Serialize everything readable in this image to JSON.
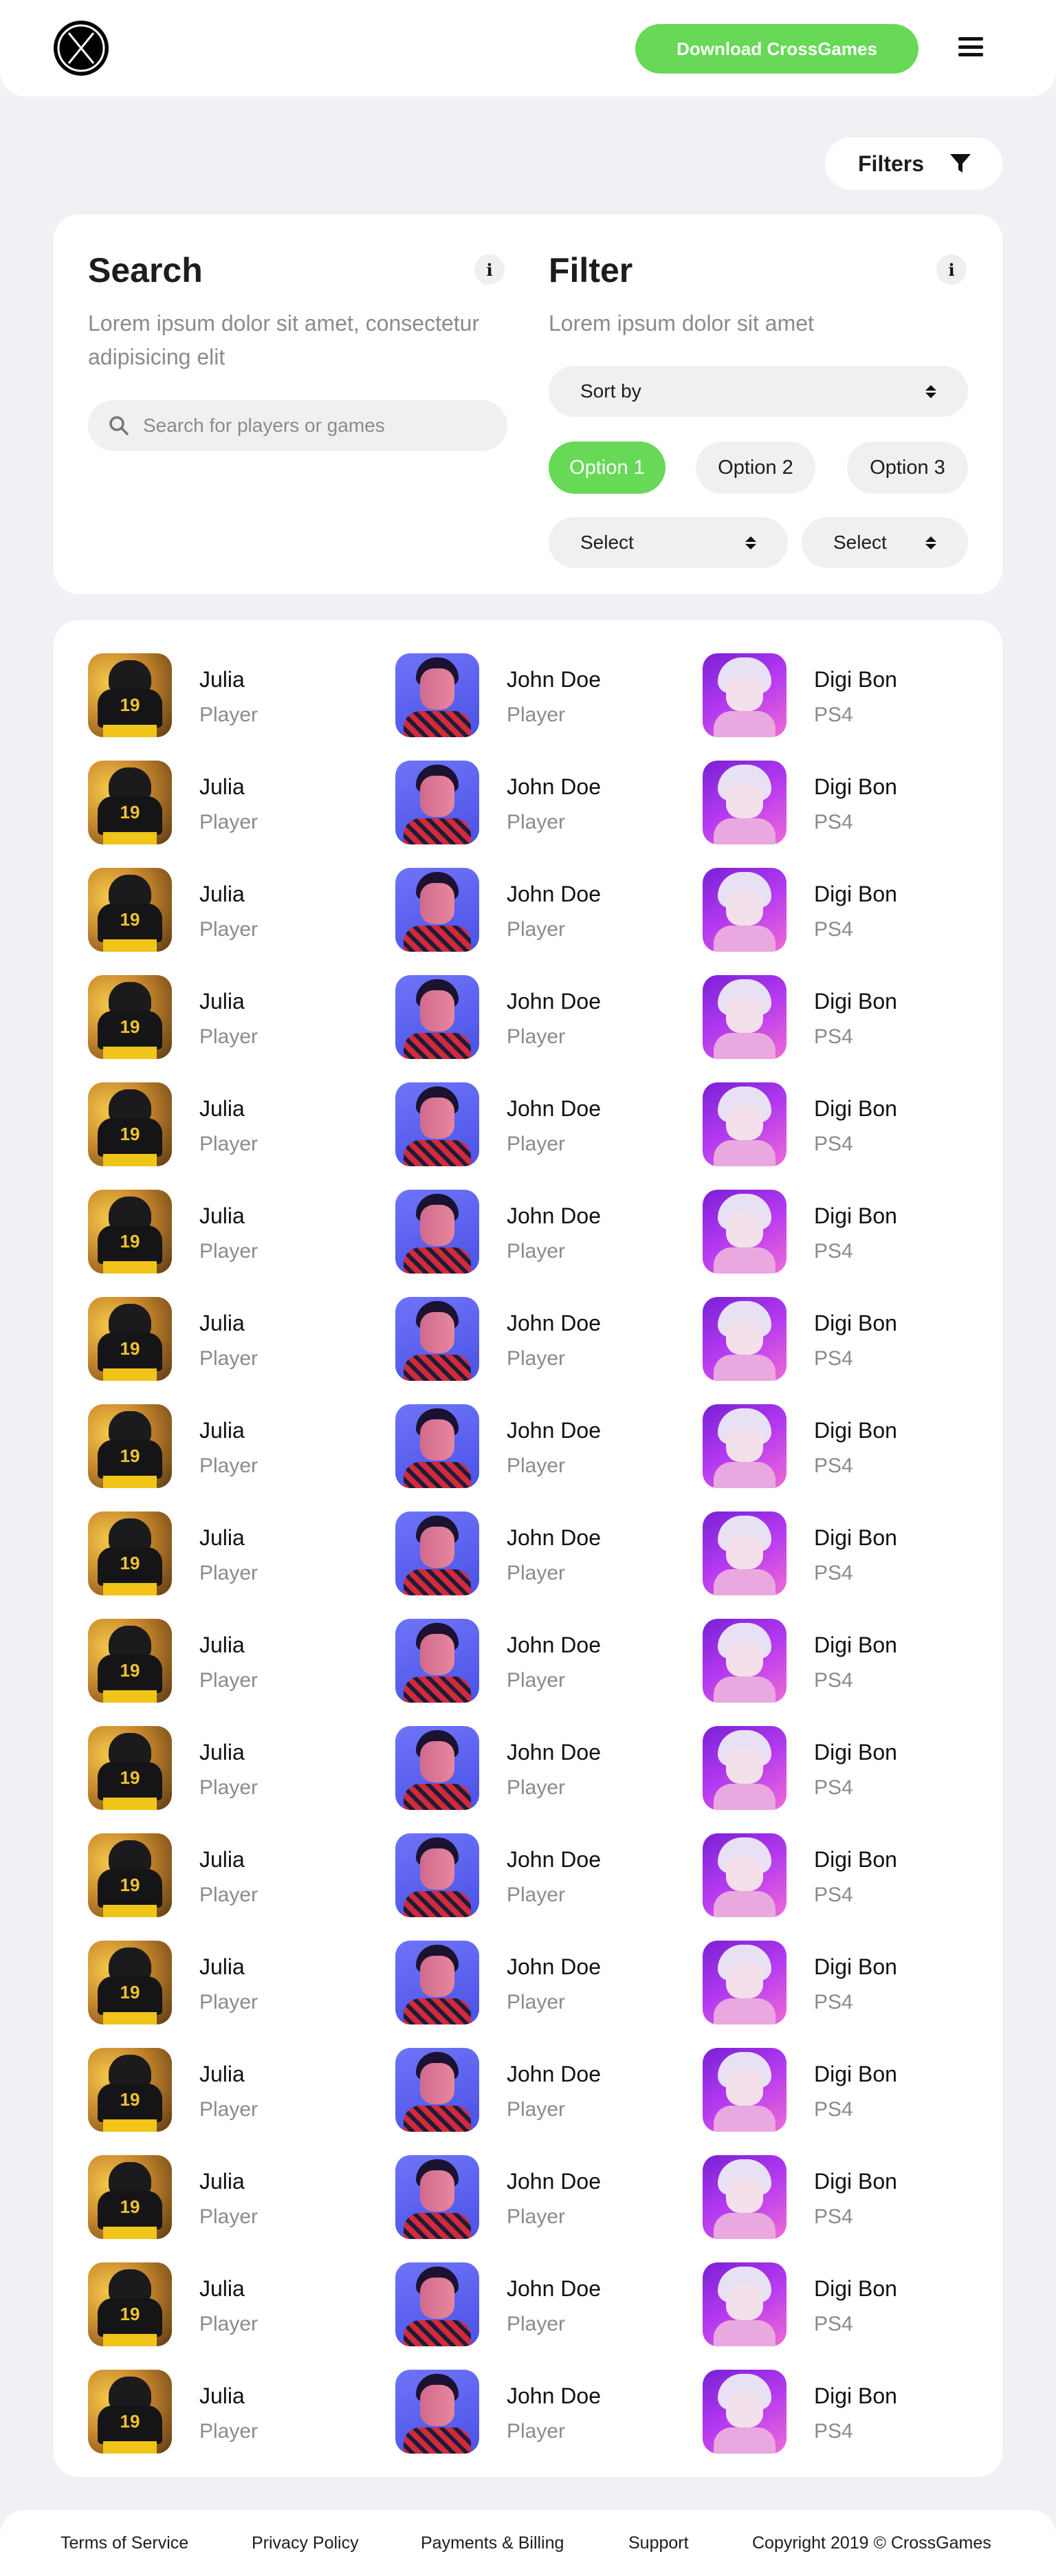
{
  "header": {
    "logo_icon": "crossgames-x-logo-icon",
    "download_label": "Download CrossGames",
    "menu_icon": "hamburger-menu-icon",
    "accent_color": "#67d957"
  },
  "filters_pill": {
    "label": "Filters",
    "icon": "funnel-icon"
  },
  "search": {
    "title": "Search",
    "description": "Lorem ipsum dolor sit amet, consectetur adipisicing elit",
    "placeholder": "Search for players or games",
    "value": "",
    "info_icon": "info-icon"
  },
  "filter": {
    "title": "Filter",
    "description": "Lorem ipsum dolor sit amet",
    "sort_by": "Sort by",
    "options": [
      {
        "label": "Option 1",
        "active": true
      },
      {
        "label": "Option 2",
        "active": false
      },
      {
        "label": "Option 3",
        "active": false
      }
    ],
    "selects": [
      "Select",
      "Select"
    ],
    "info_icon": "info-icon"
  },
  "grid": {
    "columns": [
      {
        "name": "Julia",
        "subtitle": "Player",
        "avatar": "julia"
      },
      {
        "name": "John Doe",
        "subtitle": "Player",
        "avatar": "john"
      },
      {
        "name": "Digi Bon",
        "subtitle": "PS4",
        "avatar": "digi"
      }
    ],
    "row_count": 17
  },
  "footer": {
    "links": [
      "Terms of Service",
      "Privacy Policy",
      "Payments & Billing",
      "Support"
    ],
    "copyright": "Copyright 2019 © CrossGames"
  }
}
